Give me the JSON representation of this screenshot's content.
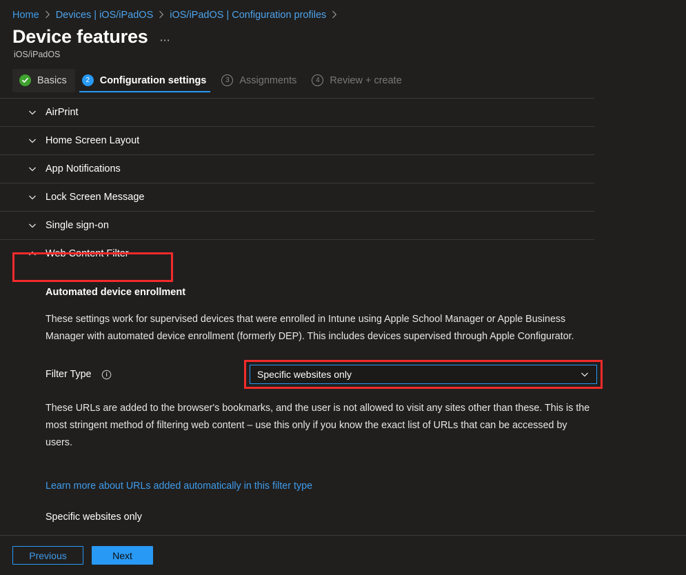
{
  "breadcrumb": {
    "items": [
      {
        "label": "Home"
      },
      {
        "label": "Devices | iOS/iPadOS"
      },
      {
        "label": "iOS/iPadOS | Configuration profiles"
      }
    ]
  },
  "header": {
    "title": "Device features",
    "subtitle": "iOS/iPadOS",
    "more_icon": "ellipsis-horizontal-icon"
  },
  "tabs": [
    {
      "label": "Basics",
      "badge": "check",
      "state": "completed"
    },
    {
      "label": "Configuration settings",
      "badge": "2",
      "state": "active"
    },
    {
      "label": "Assignments",
      "badge": "3",
      "state": "disabled"
    },
    {
      "label": "Review + create",
      "badge": "4",
      "state": "disabled"
    }
  ],
  "sections": [
    {
      "label": "AirPrint",
      "expanded": false,
      "icon": "chevron-down-icon"
    },
    {
      "label": "Home Screen Layout",
      "expanded": false,
      "icon": "chevron-down-icon"
    },
    {
      "label": "App Notifications",
      "expanded": false,
      "icon": "chevron-down-icon"
    },
    {
      "label": "Lock Screen Message",
      "expanded": false,
      "icon": "chevron-down-icon"
    },
    {
      "label": "Single sign-on",
      "expanded": false,
      "icon": "chevron-down-icon"
    },
    {
      "label": "Web Content Filter",
      "expanded": true,
      "icon": "chevron-up-icon"
    }
  ],
  "panel": {
    "heading": "Automated device enrollment",
    "description": "These settings work for supervised devices that were enrolled in Intune using Apple School Manager or Apple Business Manager with automated device enrollment (formerly DEP). This includes devices supervised through Apple Configurator.",
    "filter_type_label": "Filter Type",
    "filter_type_info_icon": "info-icon",
    "filter_type_value": "Specific websites only",
    "filter_type_chevron": "chevron-down-icon",
    "filter_description": "These URLs are added to the browser's bookmarks, and the user is not allowed to visit any sites other than these. This is the most stringent method of filtering web content – use this only if you know the exact list of URLs that can be accessed by users.",
    "learn_more_link": "Learn more about URLs added automatically in this filter type",
    "tail_label": "Specific websites only"
  },
  "footer": {
    "previous_label": "Previous",
    "next_label": "Next"
  },
  "colors": {
    "background": "#201f1e",
    "accent_blue": "#2899f5",
    "link_blue": "#3f9bea",
    "annotation_red": "#f32b2b",
    "success_green": "#3fa22f",
    "divider": "#3b3a39"
  }
}
